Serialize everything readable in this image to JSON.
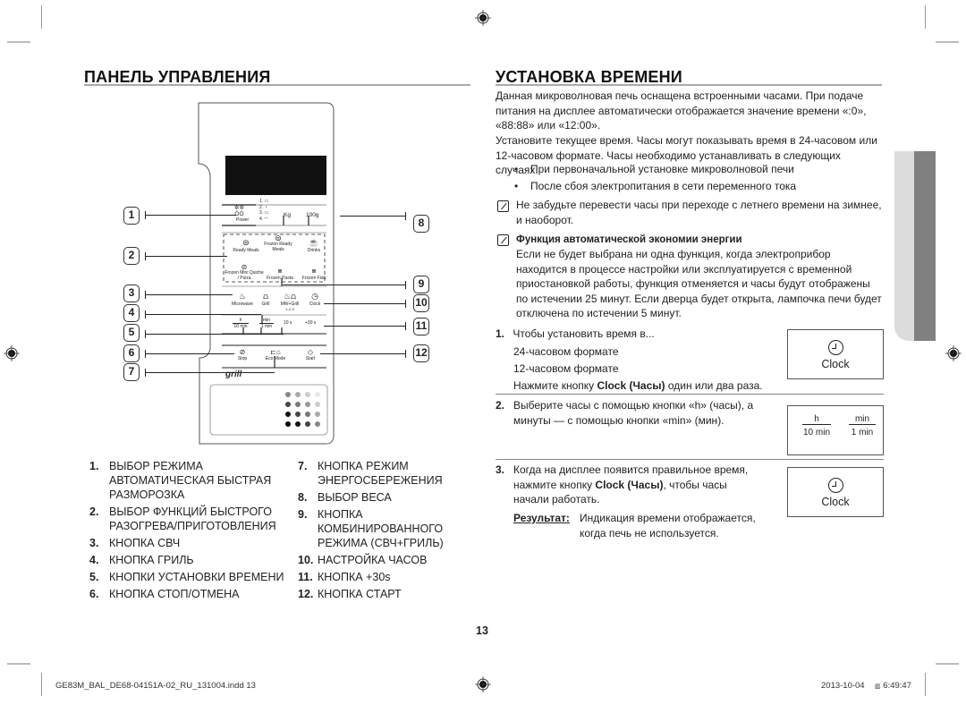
{
  "left_section": {
    "title": "ПАНЕЛЬ УПРАВЛЕНИЯ",
    "panel": {
      "power_label": "Power",
      "category_list": [
        "1.",
        "2.",
        "3.",
        "4."
      ],
      "weight_labels": [
        "Kg",
        "100g"
      ],
      "auto_menu": [
        {
          "label": "Ready Meals",
          "icon": "plate-icon"
        },
        {
          "label": "Frozen Ready Meals",
          "icon": "frozen-plate-icon"
        },
        {
          "label": "Drinks",
          "icon": "cup-icon"
        },
        {
          "label": "Frozen Mini Quiche / Pizza",
          "icon": "frozen-pizza-icon"
        },
        {
          "label": "Frozen Pasta",
          "icon": "frozen-pasta-icon"
        },
        {
          "label": "Frozen Fish",
          "icon": "frozen-fish-icon"
        }
      ],
      "mode_buttons": [
        {
          "label": "Microwave",
          "icon": "microwave-icon"
        },
        {
          "label": "Grill",
          "icon": "grill-icon"
        },
        {
          "label": "MW+Grill",
          "sublabel": "1-2-3",
          "icon": "mw-grill-icon"
        },
        {
          "label": "Clock",
          "icon": "clock-icon"
        }
      ],
      "time_buttons": [
        {
          "top": "h",
          "bottom": "10 min"
        },
        {
          "top": "min",
          "bottom": "1 min"
        },
        {
          "label": "10 s"
        },
        {
          "label": "+30 s"
        }
      ],
      "control_buttons": [
        {
          "label": "Stop",
          "icon": "stop-icon"
        },
        {
          "label": "Eco Mode",
          "icon": "eco-mode-icon"
        },
        {
          "label": "Start",
          "icon": "start-icon"
        }
      ],
      "brand_logo": "grill"
    },
    "callouts_left": [
      "1",
      "2",
      "3",
      "4",
      "5",
      "6",
      "7"
    ],
    "callouts_right": [
      "8",
      "9",
      "10",
      "11",
      "12"
    ],
    "legend_col1": [
      {
        "num": "1.",
        "text": "ВЫБОР РЕЖИМА\nАВТОМАТИЧЕСКАЯ БЫСТРАЯ\nРАЗМОРОЗКА"
      },
      {
        "num": "2.",
        "text": "ВЫБОР ФУНКЦИЙ БЫСТРОГО\nРАЗОГРЕВА/ПРИГОТОВЛЕНИЯ"
      },
      {
        "num": "3.",
        "text": "КНОПКА СВЧ"
      },
      {
        "num": "4.",
        "text": "КНОПКА ГРИЛЬ"
      },
      {
        "num": "5.",
        "text": "КНОПКИ УСТАНОВКИ ВРЕМЕНИ"
      },
      {
        "num": "6.",
        "text": "КНОПКА СТОП/ОТМЕНА"
      }
    ],
    "legend_col2": [
      {
        "num": "7.",
        "text": "КНОПКА РЕЖИМ\nЭНЕРГОСБЕРЕЖЕНИЯ"
      },
      {
        "num": "8.",
        "text": "ВЫБОР ВЕСА"
      },
      {
        "num": "9.",
        "text": "КНОПКА\nКОМБИНИРОВАННОГО\nРЕЖИМА (СВЧ+ГРИЛЬ)"
      },
      {
        "num": "10.",
        "text": "НАСТРОЙКА ЧАСОВ"
      },
      {
        "num": "11.",
        "text": "КНОПКА +30s"
      },
      {
        "num": "12.",
        "text": "КНОПКА СТАРТ"
      }
    ]
  },
  "right_section": {
    "title": "УСТАНОВКА ВРЕМЕНИ",
    "intro_1": "Данная микроволновая печь оснащена встроенными часами. При подаче питания на дисплее автоматически отображается значение времени «:0», «88:88» или «12:00».",
    "intro_2": "Установите текущее время. Часы могут показывать время в 24-часовом или 12-часовом формате. Часы необходимо устанавливать в следующих случаях.",
    "bullets": [
      "При первоначальной установке микроволновой печи",
      "После сбоя электропитания в сети переменного тока"
    ],
    "note_1": "Не забудьте перевести часы при переходе с летнего времени на зимнее, и наоборот.",
    "note_2_title": "Функция автоматической экономии энергии",
    "note_2_body": "Если не будет выбрана ни одна функция, когда электроприбор находится в процессе настройки или эксплуатируется с временной приостановкой работы, функция отменяется и часы будут отображены по истечении 25 минут. Если дверца будет открыта, лампочка печи будет отключена по истечении 5 минут.",
    "steps": [
      {
        "num": "1.",
        "lines": [
          "Чтобы установить время в...",
          "24-часовом формате",
          "12-часовом формате"
        ],
        "press_prefix": "Нажмите кнопку ",
        "press_bold": "Clock (Часы)",
        "press_suffix": " один или два раза.",
        "figure_label": "Clock"
      },
      {
        "num": "2.",
        "text": "Выберите часы с помощью кнопки «h» (часы), а минуты — с помощью кнопки «min» (мин).",
        "figure": {
          "h_top": "h",
          "h_bottom": "10 min",
          "m_top": "min",
          "m_bottom": "1 min"
        }
      },
      {
        "num": "3.",
        "text_prefix": "Когда на дисплее появится правильное время, нажмите кнопку ",
        "text_bold": "Clock (Часы)",
        "text_suffix": ", чтобы часы начали работать.",
        "result_label": "Результат:",
        "result_text": "Индикация времени отображается, когда печь не используется.",
        "figure_label": "Clock"
      }
    ]
  },
  "page_number": "13",
  "footer": {
    "file": "GE83M_BAL_DE68-04151A-02_RU_131004.indd   13",
    "date": "2013-10-04",
    "time": "6:49:47"
  }
}
